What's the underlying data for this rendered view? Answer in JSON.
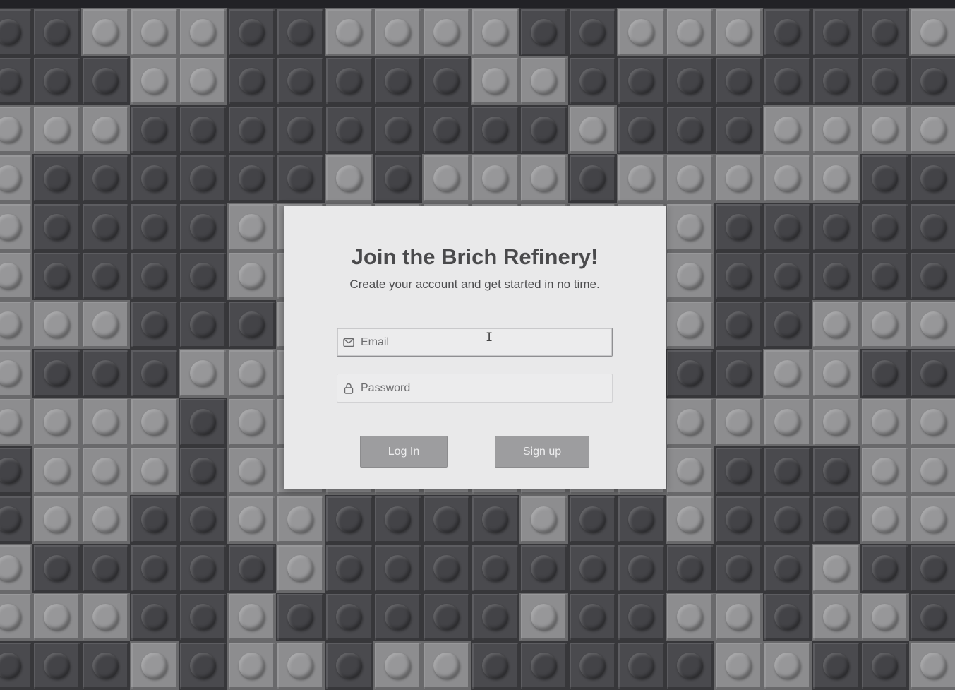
{
  "signup_card": {
    "title": "Join the Brich Refinery!",
    "subtitle": "Create your account and get started in no time.",
    "email_placeholder": "Email",
    "password_placeholder": "Password",
    "login_label": "Log In",
    "signup_label": "Sign up"
  },
  "icons": {
    "email": "envelope-icon",
    "password": "lock-icon"
  },
  "colors": {
    "dark_brick": "#4a4a4e",
    "light_brick": "#8d8d8f",
    "card_background": "#e9e9ea",
    "button_background": "#9d9d9f"
  }
}
